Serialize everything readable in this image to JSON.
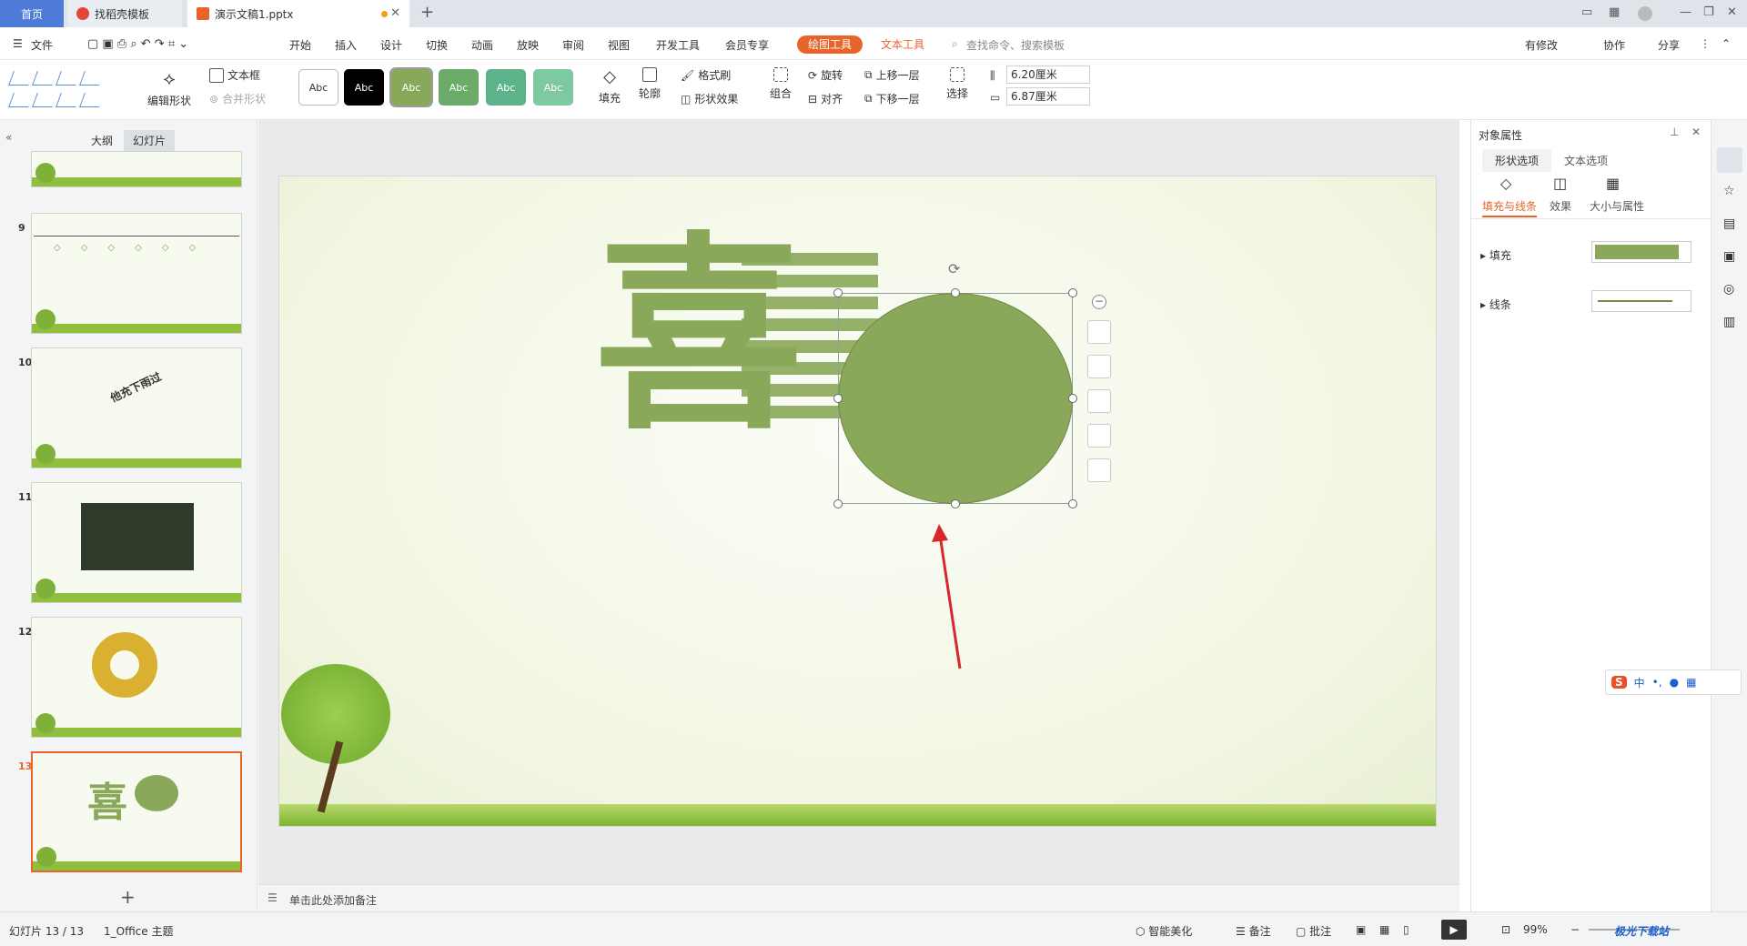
{
  "tabs": {
    "home": "首页",
    "template": "找稻壳模板",
    "document": "演示文稿1.pptx"
  },
  "menu": {
    "file": "文件",
    "items": [
      "开始",
      "插入",
      "设计",
      "切换",
      "动画",
      "放映",
      "审阅",
      "视图",
      "开发工具",
      "会员专享"
    ],
    "draw_tools": "绘图工具",
    "text_tools": "文本工具",
    "search_placeholder": "查找命令、搜索模板",
    "modified": "有修改",
    "collab": "协作",
    "share": "分享"
  },
  "ribbon": {
    "edit_shape": "编辑形状",
    "text_box": "文本框",
    "merge_shape": "合并形状",
    "style_label": "Abc",
    "fill": "填充",
    "outline": "轮廓",
    "format_brush": "格式刷",
    "shape_effect": "形状效果",
    "group": "组合",
    "rotate": "旋转",
    "align": "对齐",
    "bring_forward": "上移一层",
    "send_backward": "下移一层",
    "select": "选择",
    "height": "6.20厘米",
    "width": "6.87厘米"
  },
  "colors": {
    "accent": "#e9642a",
    "shape_green": "#8aa85a",
    "tab_blue": "#4f7bd8"
  },
  "left": {
    "outline_tab": "大纲",
    "slides_tab": "幻灯片",
    "slides": [
      {
        "num": "9"
      },
      {
        "num": "10",
        "text": "他充下雨过"
      },
      {
        "num": "11"
      },
      {
        "num": "12"
      },
      {
        "num": "13"
      }
    ]
  },
  "slide": {
    "char1": "喜",
    "notes_placeholder": "单击此处添加备注"
  },
  "right": {
    "title": "对象属性",
    "tab_shape": "形状选项",
    "tab_text": "文本选项",
    "sub_fill_line": "填充与线条",
    "sub_effect": "效果",
    "sub_size": "大小与属性",
    "fill": "填充",
    "line": "线条"
  },
  "status": {
    "slide_count": "幻灯片 13 / 13",
    "theme": "1_Office 主题",
    "smart": "智能美化",
    "notes": "备注",
    "comment": "批注",
    "zoom": "99%"
  },
  "ime": {
    "lang": "中"
  },
  "watermark": "极光下载站"
}
